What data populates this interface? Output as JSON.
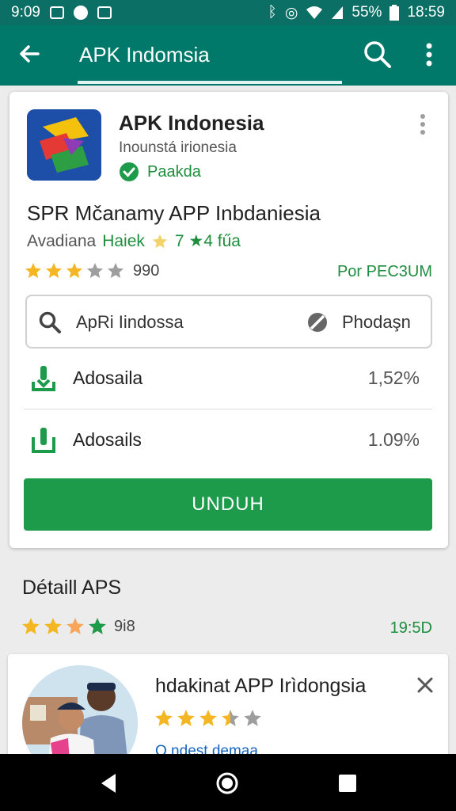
{
  "status_bar": {
    "time_left": "9:09",
    "battery": "55%",
    "time": "18:59"
  },
  "app_bar": {
    "title": "APK Indomsia",
    "icons": [
      "back-arrow-icon",
      "search-icon",
      "more-vert-icon"
    ]
  },
  "card": {
    "app_name": "APK Indonesia",
    "developer": "Inounstá irionesia",
    "verified_label": "Paakda",
    "headline": "SPR Mčanamy APP Inbdaniesia",
    "subline_prefix": "Avadiana",
    "subline_highlight": "Haiek",
    "subline_suffix": "7 ★4 fűa",
    "rating": 3,
    "rating_count": "990",
    "rating_right": "Por PEC3UM",
    "search_placeholder": "ApRi Iindossa",
    "search_option": "Phodaşn",
    "downloads": [
      {
        "name": "Adosaila",
        "percent": "1,52%"
      },
      {
        "name": "Adosails",
        "percent": "1.09%"
      }
    ],
    "button_label": "UNDUH"
  },
  "details": {
    "title": "Détaill APS",
    "rating_count": "9i8",
    "right_label": "19:5D"
  },
  "bottom_card": {
    "title": "hdakinat APP Irìdongsia",
    "rating": 3.5,
    "subtitle": "Q ndest demaa"
  },
  "colors": {
    "status_bar": "#0b6f66",
    "app_bar": "#00796b",
    "accent_green": "#1e9b4a",
    "star_gold": "#f5b623",
    "star_grey": "#9e9e9e"
  }
}
